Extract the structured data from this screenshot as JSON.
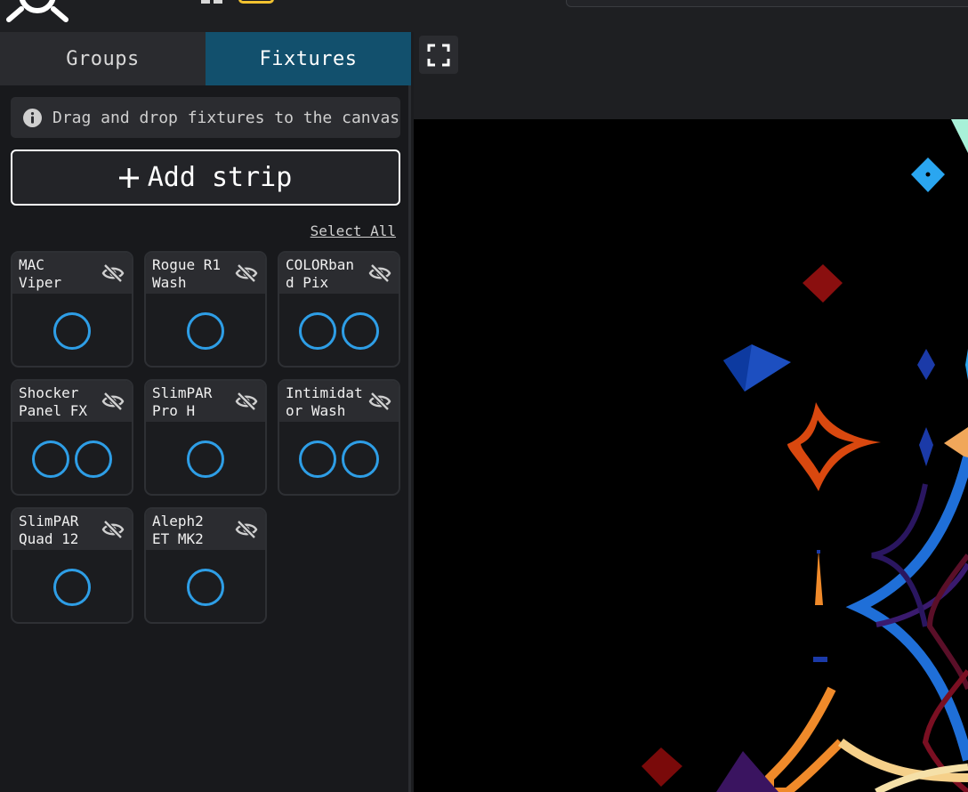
{
  "tabs": [
    {
      "label": "Groups",
      "active": false
    },
    {
      "label": "Fixtures",
      "active": true
    }
  ],
  "info": {
    "text": "Drag and drop fixtures to the canvas",
    "icon": "info-icon"
  },
  "add_strip": {
    "label": "Add strip",
    "icon": "plus-icon"
  },
  "select_all": "Select All",
  "fixtures": [
    {
      "name": "MAC\nViper",
      "dots": 1
    },
    {
      "name": "Rogue R1\nWash",
      "dots": 1
    },
    {
      "name": "COLORban\nd Pix",
      "dots": 2
    },
    {
      "name": "Shocker\nPanel FX",
      "dots": 2
    },
    {
      "name": "SlimPAR\nPro H",
      "dots": 1
    },
    {
      "name": "Intimidat\nor Wash",
      "dots": 2
    },
    {
      "name": "SlimPAR\nQuad 12",
      "dots": 1
    },
    {
      "name": "Aleph2\nET MK2",
      "dots": 1
    }
  ],
  "colors": {
    "active_tab": "#12506d",
    "fixture_dot": "#2e9ee6",
    "accent_yellow": "#f2c230"
  },
  "canvas_toolbar": {
    "fullscreen_icon": "fullscreen-icon"
  }
}
